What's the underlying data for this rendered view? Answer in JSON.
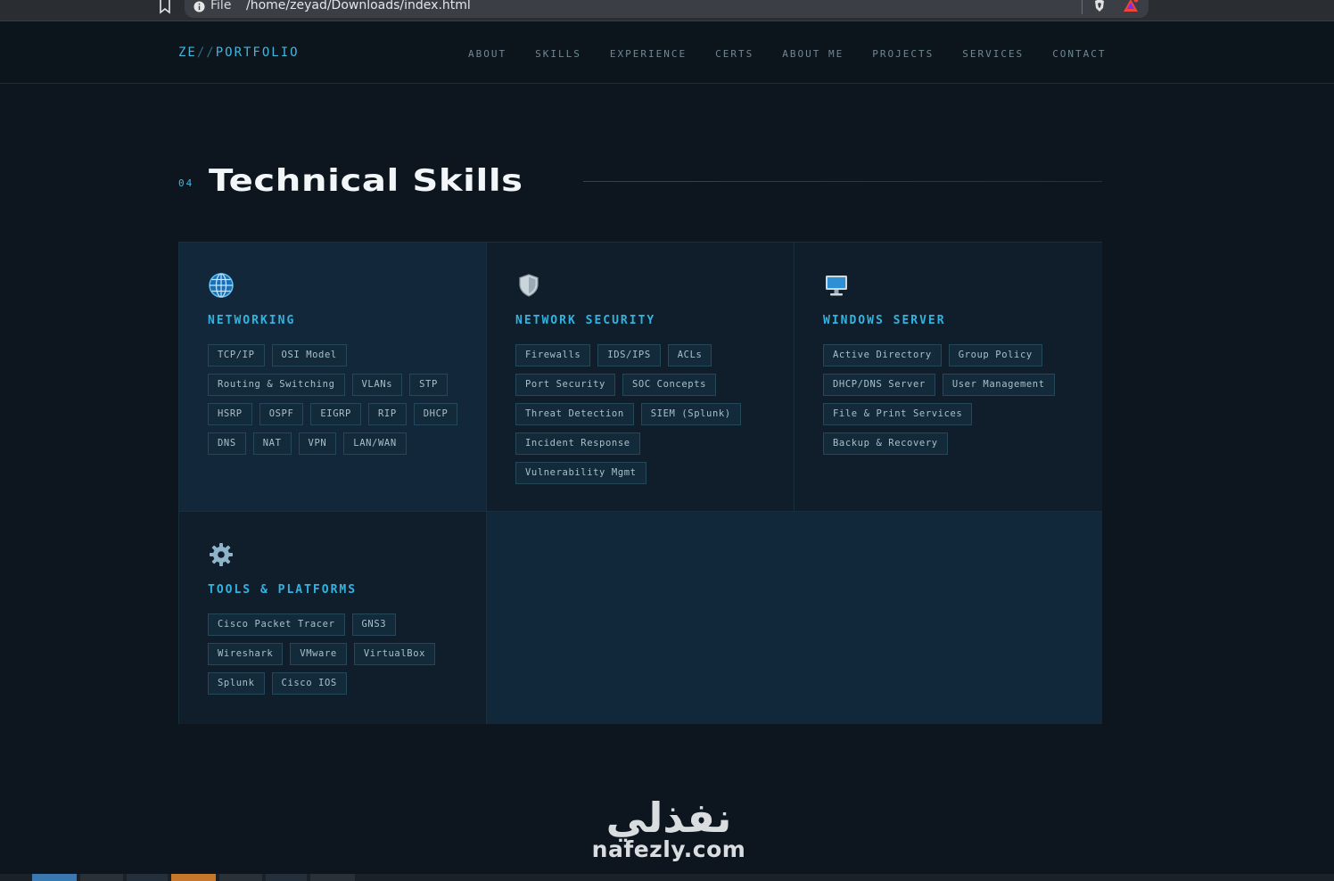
{
  "browser": {
    "scheme": "File",
    "url": "/home/zeyad/Downloads/index.html"
  },
  "nav": {
    "logo_prefix": "ZE",
    "logo_slashes": "//",
    "logo_suffix": "PORTFOLIO",
    "links": [
      "ABOUT",
      "SKILLS",
      "EXPERIENCE",
      "CERTS",
      "ABOUT ME",
      "PROJECTS",
      "SERVICES",
      "CONTACT"
    ]
  },
  "section": {
    "number": "04",
    "title": "Technical Skills"
  },
  "cards": [
    {
      "icon": "globe-icon",
      "title": "NETWORKING",
      "rows": [
        [
          "TCP/IP",
          "OSI Model"
        ],
        [
          "Routing & Switching",
          "VLANs",
          "STP"
        ],
        [
          "HSRP",
          "OSPF",
          "EIGRP",
          "RIP",
          "DHCP"
        ],
        [
          "DNS",
          "NAT",
          "VPN",
          "LAN/WAN"
        ]
      ]
    },
    {
      "icon": "shield-icon",
      "title": "NETWORK SECURITY",
      "rows": [
        [
          "Firewalls",
          "IDS/IPS",
          "ACLs"
        ],
        [
          "Port Security",
          "SOC Concepts"
        ],
        [
          "Threat Detection",
          "SIEM (Splunk)"
        ],
        [
          "Incident Response"
        ],
        [
          "Vulnerability Mgmt"
        ]
      ]
    },
    {
      "icon": "desktop-computer-icon",
      "title": "WINDOWS SERVER",
      "rows": [
        [
          "Active Directory",
          "Group Policy"
        ],
        [
          "DHCP/DNS Server",
          "User Management"
        ],
        [
          "File & Print Services"
        ],
        [
          "Backup & Recovery"
        ]
      ]
    },
    {
      "icon": "gear-icon",
      "title": "TOOLS & PLATFORMS",
      "rows": [
        [
          "Cisco Packet Tracer",
          "GNS3"
        ],
        [
          "Wireshark",
          "VMware",
          "VirtualBox"
        ],
        [
          "Splunk",
          "Cisco IOS"
        ]
      ]
    }
  ],
  "watermark": {
    "arabic": "نفذلي",
    "latin": "nafezly.com"
  },
  "colors": {
    "accent": "#33b3e0",
    "background": "#0d161f"
  }
}
